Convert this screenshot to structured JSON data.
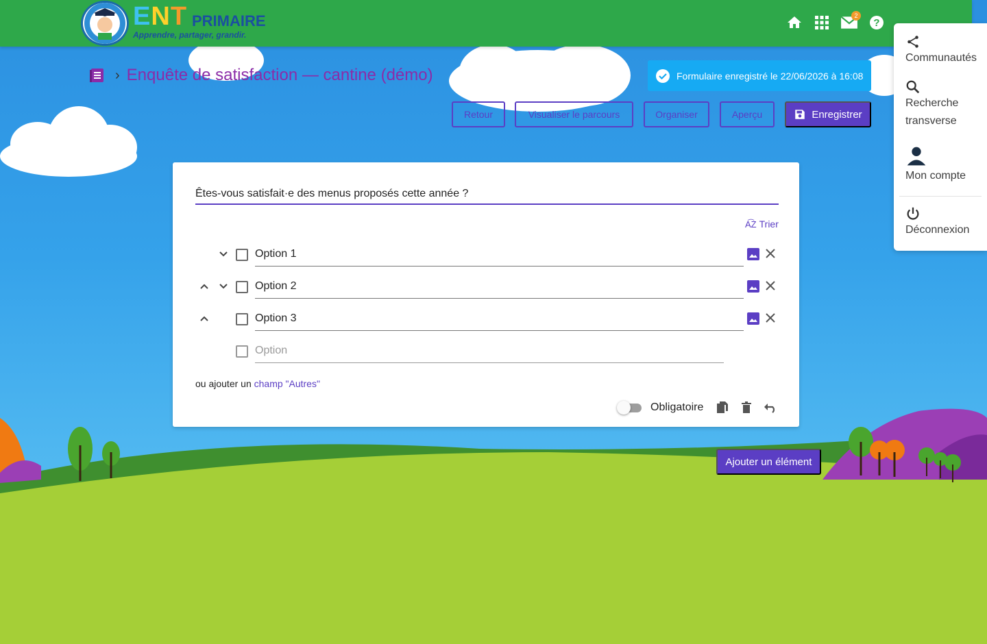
{
  "app": {
    "logo_ent": "ENT",
    "logo_primaire": "PRIMAIRE",
    "logo_tagline": "Apprendre, partager, grandir.",
    "mail_count": "2"
  },
  "topbar_icons": [
    "home-icon",
    "apps-grid-icon",
    "mail-icon",
    "help-icon"
  ],
  "side_menu": {
    "items": [
      {
        "icon": "share-icon",
        "label": "Communautés"
      },
      {
        "icon": "search-icon",
        "label": "Recherche transverse"
      },
      {
        "icon": "account-icon",
        "label": "Mon compte"
      },
      {
        "icon": "power-icon",
        "label": "Déconnexion"
      }
    ]
  },
  "breadcrumb": {
    "icon": "form-icon",
    "title": "Enquête de satisfaction — cantine (démo)"
  },
  "toast": {
    "text": "Formulaire enregistré le 22/06/2026 à 16:08"
  },
  "toolbar": {
    "back_label": "Retour",
    "preview_path_label": "Visualiser le parcours",
    "organize_label": "Organiser",
    "preview_label": "Aperçu",
    "save_label": "Enregistrer"
  },
  "question": {
    "title": "Êtes-vous satisfait·e des menus proposés cette année ?",
    "sort_label": "Trier",
    "options": [
      {
        "value": "Option 1",
        "up": false,
        "down": true
      },
      {
        "value": "Option 2",
        "up": true,
        "down": true
      },
      {
        "value": "Option 3",
        "up": true,
        "down": false
      }
    ],
    "new_option_placeholder": "Option",
    "others_prefix": "ou ajouter un ",
    "others_link": "champ \"Autres\"",
    "required_label": "Obligatoire",
    "required": false
  },
  "add_element_label": "Ajouter un élément",
  "colors": {
    "primary": "#5b3ec4",
    "topbar": "#2ea84a",
    "toast": "#16aaf3",
    "title": "#8b2ca8"
  }
}
